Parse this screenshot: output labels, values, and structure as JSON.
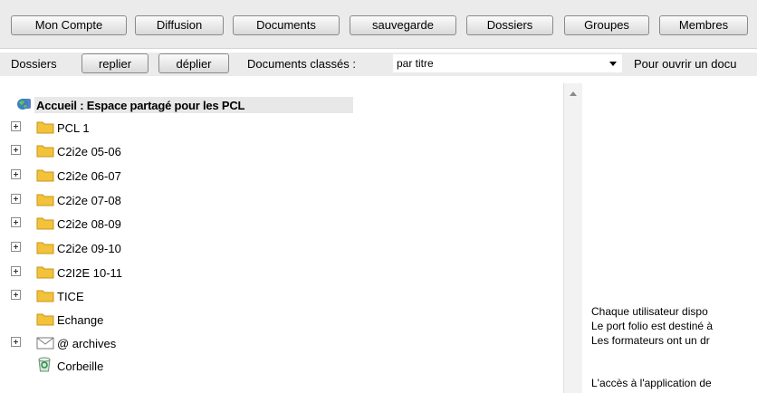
{
  "toolbar": {
    "buttons": [
      {
        "label": "Mon Compte"
      },
      {
        "label": "Diffusion"
      },
      {
        "label": "Documents"
      },
      {
        "label": "sauvegarde"
      },
      {
        "label": "Dossiers"
      },
      {
        "label": "Groupes"
      },
      {
        "label": "Membres"
      }
    ]
  },
  "row2": {
    "dossiers_label": "Dossiers",
    "replier_label": "replier",
    "deplier_label": "déplier",
    "documents_classes_label": "Documents classés :",
    "sort_select_value": "par titre",
    "hint_text": "Pour ouvrir un docu"
  },
  "tree": {
    "root_label": "Accueil : Espace partagé pour les PCL",
    "nodes": [
      {
        "label": "PCL 1",
        "icon": "folder-icon",
        "expandable": true
      },
      {
        "label": "C2i2e 05-06",
        "icon": "folder-icon",
        "expandable": true
      },
      {
        "label": "C2i2e 06-07",
        "icon": "folder-icon",
        "expandable": true
      },
      {
        "label": "C2i2e 07-08",
        "icon": "folder-icon",
        "expandable": true
      },
      {
        "label": "C2i2e 08-09",
        "icon": "folder-icon",
        "expandable": true
      },
      {
        "label": "C2i2e 09-10",
        "icon": "folder-icon",
        "expandable": true
      },
      {
        "label": "C2I2E 10-11",
        "icon": "folder-icon",
        "expandable": true
      },
      {
        "label": "TICE",
        "icon": "folder-icon",
        "expandable": true
      },
      {
        "label": "Echange",
        "icon": "folder-icon",
        "expandable": false
      },
      {
        "label": "@ archives",
        "icon": "envelope-icon",
        "expandable": true
      },
      {
        "label": "Corbeille",
        "icon": "recycle-bin-icon",
        "expandable": false
      }
    ]
  },
  "content": {
    "lines": [
      "Chaque utilisateur dispo",
      "Le port folio est destiné à",
      "Les formateurs ont un dr",
      "",
      "L'accès à l'application de"
    ]
  }
}
